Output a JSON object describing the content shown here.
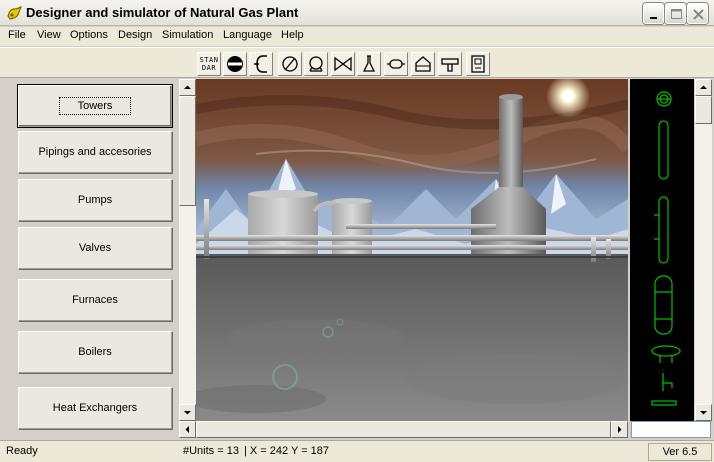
{
  "window": {
    "title": "Designer and simulator of Natural Gas Plant"
  },
  "menu": [
    {
      "label": "File"
    },
    {
      "label": "View"
    },
    {
      "label": "Options"
    },
    {
      "label": "Design"
    },
    {
      "label": "Simulation"
    },
    {
      "label": "Language"
    },
    {
      "label": "Help"
    }
  ],
  "toolbar": {
    "standard_label_line1": "STAN",
    "standard_label_line2": "DAR",
    "tools": [
      {
        "name": "standard-tool",
        "icon": "standard-text-icon"
      },
      {
        "name": "blind-flange-tool",
        "icon": "blind-flange-icon"
      },
      {
        "name": "elbow-tool",
        "icon": "elbow-pipe-icon"
      },
      {
        "name": "orifice-tool",
        "icon": "orifice-icon"
      },
      {
        "name": "pump-tool",
        "icon": "pump-icon"
      },
      {
        "name": "valve-tool",
        "icon": "gate-valve-icon"
      },
      {
        "name": "flask-tool",
        "icon": "flask-icon"
      },
      {
        "name": "drum-tool",
        "icon": "drum-icon"
      },
      {
        "name": "furnace-tool",
        "icon": "furnace-icon"
      },
      {
        "name": "nozzle-tool",
        "icon": "nozzle-icon"
      },
      {
        "name": "panel-tool",
        "icon": "panel-icon"
      }
    ]
  },
  "categories": [
    {
      "label": "Towers",
      "active": true
    },
    {
      "label": "Pipings and accesories",
      "active": false
    },
    {
      "label": "Pumps",
      "active": false
    },
    {
      "label": "Valves",
      "active": false
    },
    {
      "label": "Furnaces",
      "active": false
    },
    {
      "label": "Boilers",
      "active": false
    },
    {
      "label": "Heat Exchangers",
      "active": false
    }
  ],
  "palette": {
    "items": [
      "manhole-icon",
      "column-icon",
      "column-gauge-icon",
      "vessel-icon",
      "reboiler-icon",
      "nozzle-icon",
      "flange-icon"
    ],
    "input_value": ""
  },
  "status": {
    "ready": "Ready",
    "units": "#Units = 13",
    "coords": "| X = 242  Y = 187",
    "version": "Ver 6.5"
  },
  "colors": {
    "palette_stroke": "#00c000",
    "palette_bg": "#000000",
    "window_bg": "#d4d0c8"
  }
}
